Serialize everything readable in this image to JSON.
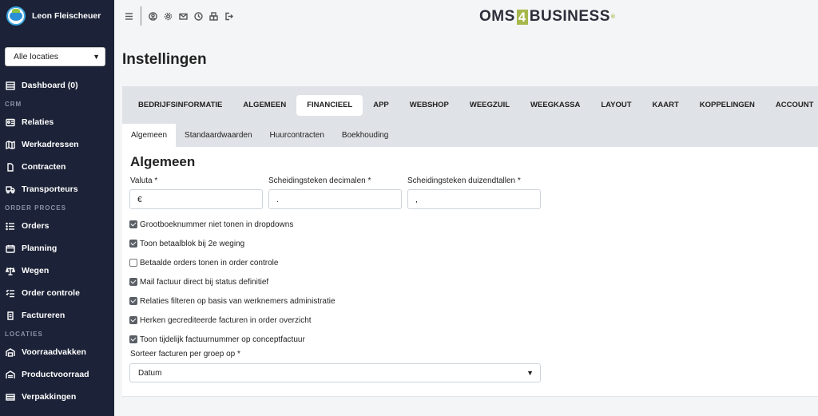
{
  "user": {
    "name": "Leon Fleischeuer"
  },
  "location_select": {
    "value": "Alle locaties"
  },
  "sidebar": {
    "dashboard": "Dashboard (0)",
    "sections": [
      {
        "title": "CRM",
        "items": [
          "Relaties",
          "Werkadressen",
          "Contracten",
          "Transporteurs"
        ]
      },
      {
        "title": "ORDER PROCES",
        "items": [
          "Orders",
          "Planning",
          "Wegen",
          "Order controle",
          "Factureren"
        ]
      },
      {
        "title": "LOCATIES",
        "items": [
          "Voorraadvakken",
          "Productvoorraad",
          "Verpakkingen"
        ]
      }
    ]
  },
  "logo": {
    "left": "OMS",
    "four": "4",
    "right": "BUSINESS",
    "reg": "®"
  },
  "page": {
    "title": "Instellingen"
  },
  "main_tabs": [
    "BEDRIJFSINFORMATIE",
    "ALGEMEEN",
    "FINANCIEEL",
    "APP",
    "WEBSHOP",
    "WEEGZUIL",
    "WEEGKASSA",
    "LAYOUT",
    "KAART",
    "KOPPELINGEN",
    "ACCOUNT"
  ],
  "main_tab_active": "FINANCIEEL",
  "sub_tabs": [
    "Algemeen",
    "Standaardwaarden",
    "Huurcontracten",
    "Boekhouding"
  ],
  "sub_tab_active": "Algemeen",
  "form": {
    "section_title": "Algemeen",
    "valuta": {
      "label": "Valuta *",
      "value": "€"
    },
    "decimal_sep": {
      "label": "Scheidingsteken decimalen *",
      "value": "."
    },
    "thousand_sep": {
      "label": "Scheidingsteken duizendtallen *",
      "value": ","
    },
    "checkboxes": [
      {
        "label": "Grootboeknummer niet tonen in dropdowns",
        "checked": true
      },
      {
        "label": "Toon betaalblok bij 2e weging",
        "checked": true
      },
      {
        "label": "Betaalde orders tonen in order controle",
        "checked": false
      },
      {
        "label": "Mail factuur direct bij status definitief",
        "checked": true
      },
      {
        "label": "Relaties filteren op basis van werknemers administratie",
        "checked": true
      },
      {
        "label": "Herken gecrediteerde facturen in order overzicht",
        "checked": true
      },
      {
        "label": "Toon tijdelijk factuurnummer op conceptfactuur",
        "checked": true
      }
    ],
    "sort": {
      "label": "Sorteer facturen per groep op *",
      "value": "Datum"
    }
  }
}
